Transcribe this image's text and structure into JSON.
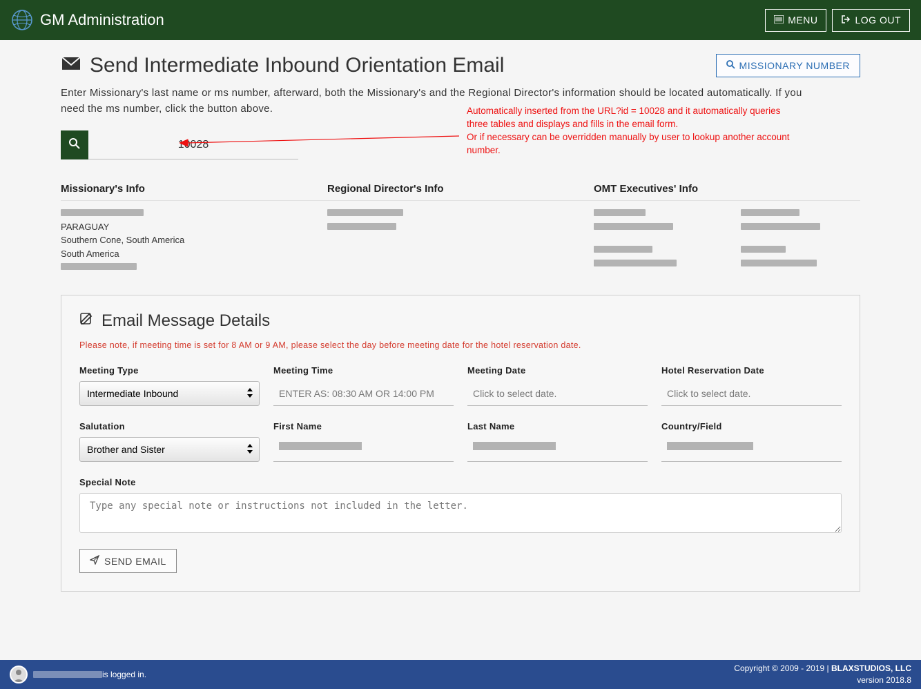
{
  "topbar": {
    "title": "GM Administration",
    "menu": "MENU",
    "logout": "LOG OUT"
  },
  "page": {
    "title": "Send Intermediate Inbound Orientation Email",
    "missionary_number_btn": "MISSIONARY NUMBER",
    "intro": "Enter Missionary's last name or ms number, afterward, both the Missionary's and the Regional Director's information should be located automatically. If you need the ms number, click the button above."
  },
  "search": {
    "value": "10028"
  },
  "annotation": {
    "text": "Automatically inserted from the URL?id = 10028 and it automatically queries three tables and displays and fills in the email form.\nOr if necessary can be overridden manually by user to lookup another account number."
  },
  "info": {
    "missionary_header": "Missionary's Info",
    "missionary_lines": [
      "PARAGUAY",
      "Southern Cone, South America",
      "South America"
    ],
    "rd_header": "Regional Director's Info",
    "omt_header": "OMT Executives' Info"
  },
  "panel": {
    "title": "Email Message Details",
    "warn": "Please note, if meeting time is set for 8 AM or 9 AM, please select the day before meeting date for the hotel reservation date.",
    "labels": {
      "meeting_type": "Meeting Type",
      "meeting_time": "Meeting Time",
      "meeting_date": "Meeting Date",
      "hotel_date": "Hotel Reservation Date",
      "salutation": "Salutation",
      "first_name": "First Name",
      "last_name": "Last Name",
      "country": "Country/Field",
      "special_note": "Special Note"
    },
    "values": {
      "meeting_type": "Intermediate Inbound",
      "salutation": "Brother and Sister"
    },
    "placeholders": {
      "meeting_time": "ENTER AS: 08:30 AM OR 14:00 PM",
      "meeting_date": "Click to select date.",
      "hotel_date": "Click to select date.",
      "special_note": "Type any special note or instructions not included in the letter."
    },
    "send_btn": "SEND EMAIL"
  },
  "footer": {
    "logged_in": " is logged in.",
    "copyright": "Copyright © 2009 - 2019 | ",
    "company": "BLAXSTUDIOS, LLC",
    "version": "version 2018.8"
  }
}
